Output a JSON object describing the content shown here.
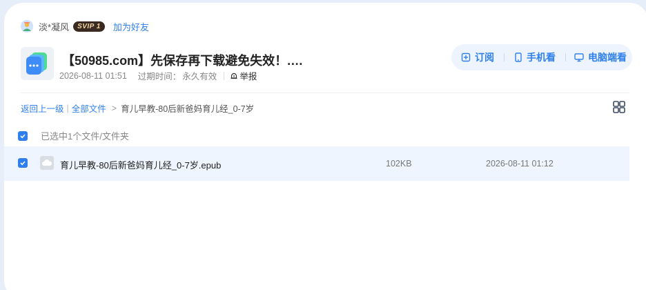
{
  "user": {
    "name": "淡*凝风",
    "badge": "SVIP 1",
    "add_friend": "加为好友"
  },
  "share": {
    "title": "【50985.com】先保存再下载避免失效！.…",
    "date": "2026-08-11 01:51",
    "expire_label": "过期时间：",
    "expire_value": "永久有效",
    "report": "举报"
  },
  "actions": {
    "subscribe": "订阅",
    "phone": "手机看",
    "pc": "电脑端看"
  },
  "breadcrumb": {
    "back": "返回上一级",
    "all_files": "全部文件",
    "current": "育儿早教-80后新爸妈育儿经_0-7岁"
  },
  "selection": {
    "text": "已选中1个文件/文件夹"
  },
  "files": [
    {
      "name": "育儿早教-80后新爸妈育儿经_0-7岁.epub",
      "size": "102KB",
      "date": "2026-08-11 01:12"
    }
  ],
  "colors": {
    "accent": "#2f80ed",
    "row_selected": "#eef5fe",
    "background": "#e6eef9"
  }
}
